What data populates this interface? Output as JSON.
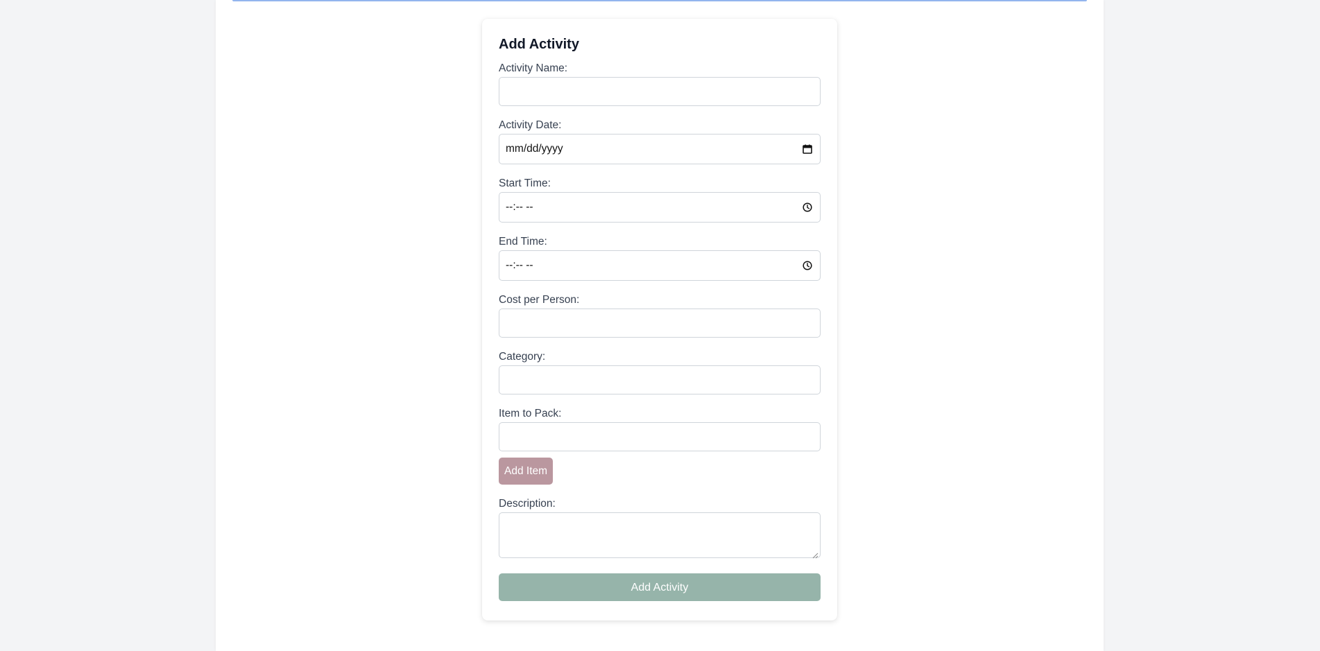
{
  "form": {
    "title": "Add Activity",
    "fields": {
      "activity_name": {
        "label": "Activity Name:",
        "value": ""
      },
      "activity_date": {
        "label": "Activity Date:",
        "placeholder": "mm/dd/yyyy",
        "icon": "calendar-icon"
      },
      "start_time": {
        "label": "Start Time:",
        "placeholder": "--:-- --",
        "icon": "clock-icon"
      },
      "end_time": {
        "label": "End Time:",
        "placeholder": "--:-- --",
        "icon": "clock-icon"
      },
      "cost_per_person": {
        "label": "Cost per Person:",
        "value": ""
      },
      "category": {
        "label": "Category:",
        "value": ""
      },
      "item_to_pack": {
        "label": "Item to Pack:",
        "value": ""
      },
      "description": {
        "label": "Description:",
        "value": ""
      }
    },
    "add_item_label": "Add Item",
    "submit_label": "Add Activity"
  },
  "colors": {
    "background": "#f3f4f6",
    "panel": "#ffffff",
    "top_accent": "#93b5ee",
    "add_item_button": "#ba979f",
    "submit_button": "#96b4aa"
  }
}
